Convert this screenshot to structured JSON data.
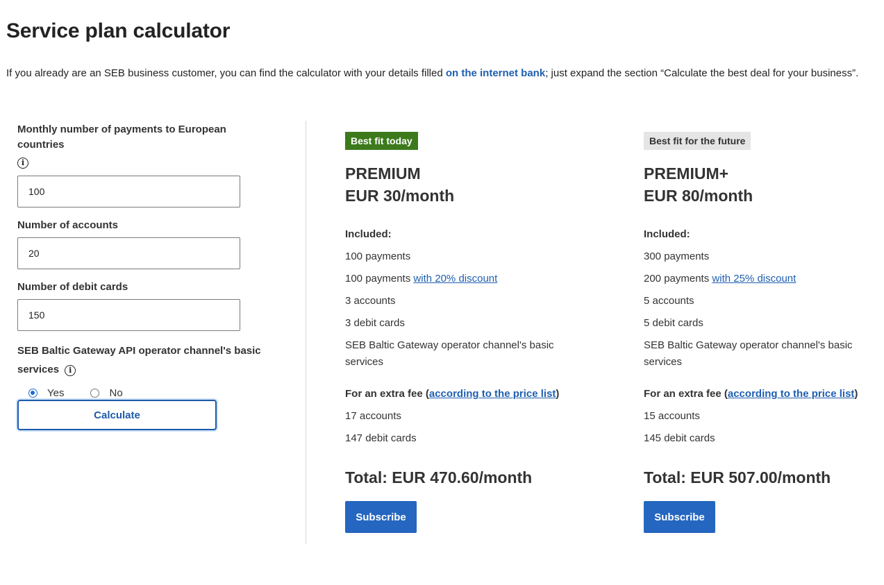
{
  "page": {
    "title": "Service plan calculator",
    "intro_before": "If you already are an SEB business customer, you can find the calculator with your details filled ",
    "intro_link": "on the internet bank",
    "intro_after": "; just expand the section “Calculate the best deal for your business”."
  },
  "form": {
    "payments_label": "Monthly number of payments to European countries",
    "payments_value": "100",
    "accounts_label": "Number of accounts",
    "accounts_value": "20",
    "cards_label": "Number of debit cards",
    "cards_value": "150",
    "gateway_label_line1": "SEB Baltic Gateway API operator channel's basic",
    "gateway_label_line2": "services",
    "radio_yes": "Yes",
    "radio_no": "No",
    "selected": "Yes",
    "calculate_label": "Calculate"
  },
  "plans": [
    {
      "badge": "Best fit today",
      "badge_color": "#3c7a1c",
      "name": "PREMIUM",
      "price": "EUR 30/month",
      "included_title": "Included:",
      "included": {
        "payments": "100 payments",
        "discount_payments_text": "100 payments ",
        "discount_link": "with 20% discount",
        "accounts": "3 accounts",
        "cards": "3 debit cards",
        "gateway_line1": "SEB Baltic Gateway operator channel's basic",
        "gateway_line2": "services"
      },
      "extra_title_before": "For an extra fee (",
      "extra_link": "according to the price list",
      "extra_title_after": ")",
      "extra": [
        "17 accounts",
        "147 debit cards"
      ],
      "total": "Total: EUR 470.60/month",
      "subscribe_label": "Subscribe"
    },
    {
      "badge": "Best fit for the future",
      "badge_color": "#e5e5e5",
      "name": "PREMIUM+",
      "price": "EUR 80/month",
      "included_title": "Included:",
      "included": {
        "payments": "300 payments",
        "discount_payments_text": "200 payments ",
        "discount_link": "with 25% discount",
        "accounts": "5 accounts",
        "cards": "5 debit cards",
        "gateway_line1": "SEB Baltic Gateway operator channel's basic",
        "gateway_line2": "services"
      },
      "extra_title_before": "For an extra fee (",
      "extra_link": "according to the price list",
      "extra_title_after": ")",
      "extra": [
        "15 accounts",
        "145 debit cards"
      ],
      "total": "Total: EUR 507.00/month",
      "subscribe_label": "Subscribe"
    }
  ],
  "colors": {
    "link": "#1f5fb0",
    "primary_button": "#2466c0",
    "badge_green": "#3c7a1c",
    "badge_grey": "#e5e5e5"
  },
  "icons": {
    "info": "info-icon"
  }
}
